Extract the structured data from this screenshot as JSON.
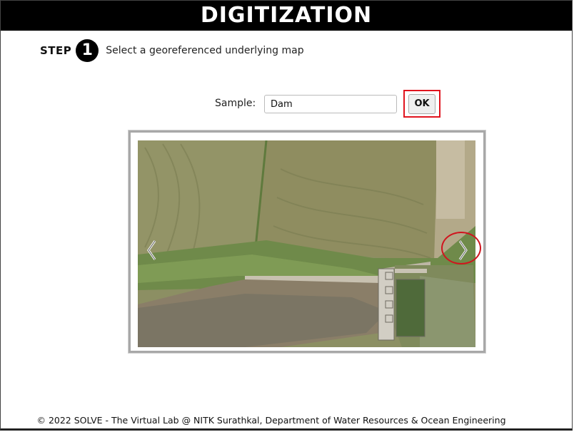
{
  "header": {
    "title": "DIGITIZATION"
  },
  "step": {
    "word": "STEP",
    "number": "1",
    "text": "Select a georeferenced underlying map"
  },
  "sample": {
    "label": "Sample:",
    "value": "Dam"
  },
  "ok_button": {
    "label": "OK"
  },
  "viewer": {
    "prev_icon": "chevron-left-icon",
    "next_icon": "chevron-right-icon"
  },
  "highlight": {
    "color": "#e0141e"
  },
  "footer": {
    "text": "© 2022 SOLVE - The Virtual Lab @ NITK Surathkal, Department of Water Resources & Ocean Engineering"
  }
}
